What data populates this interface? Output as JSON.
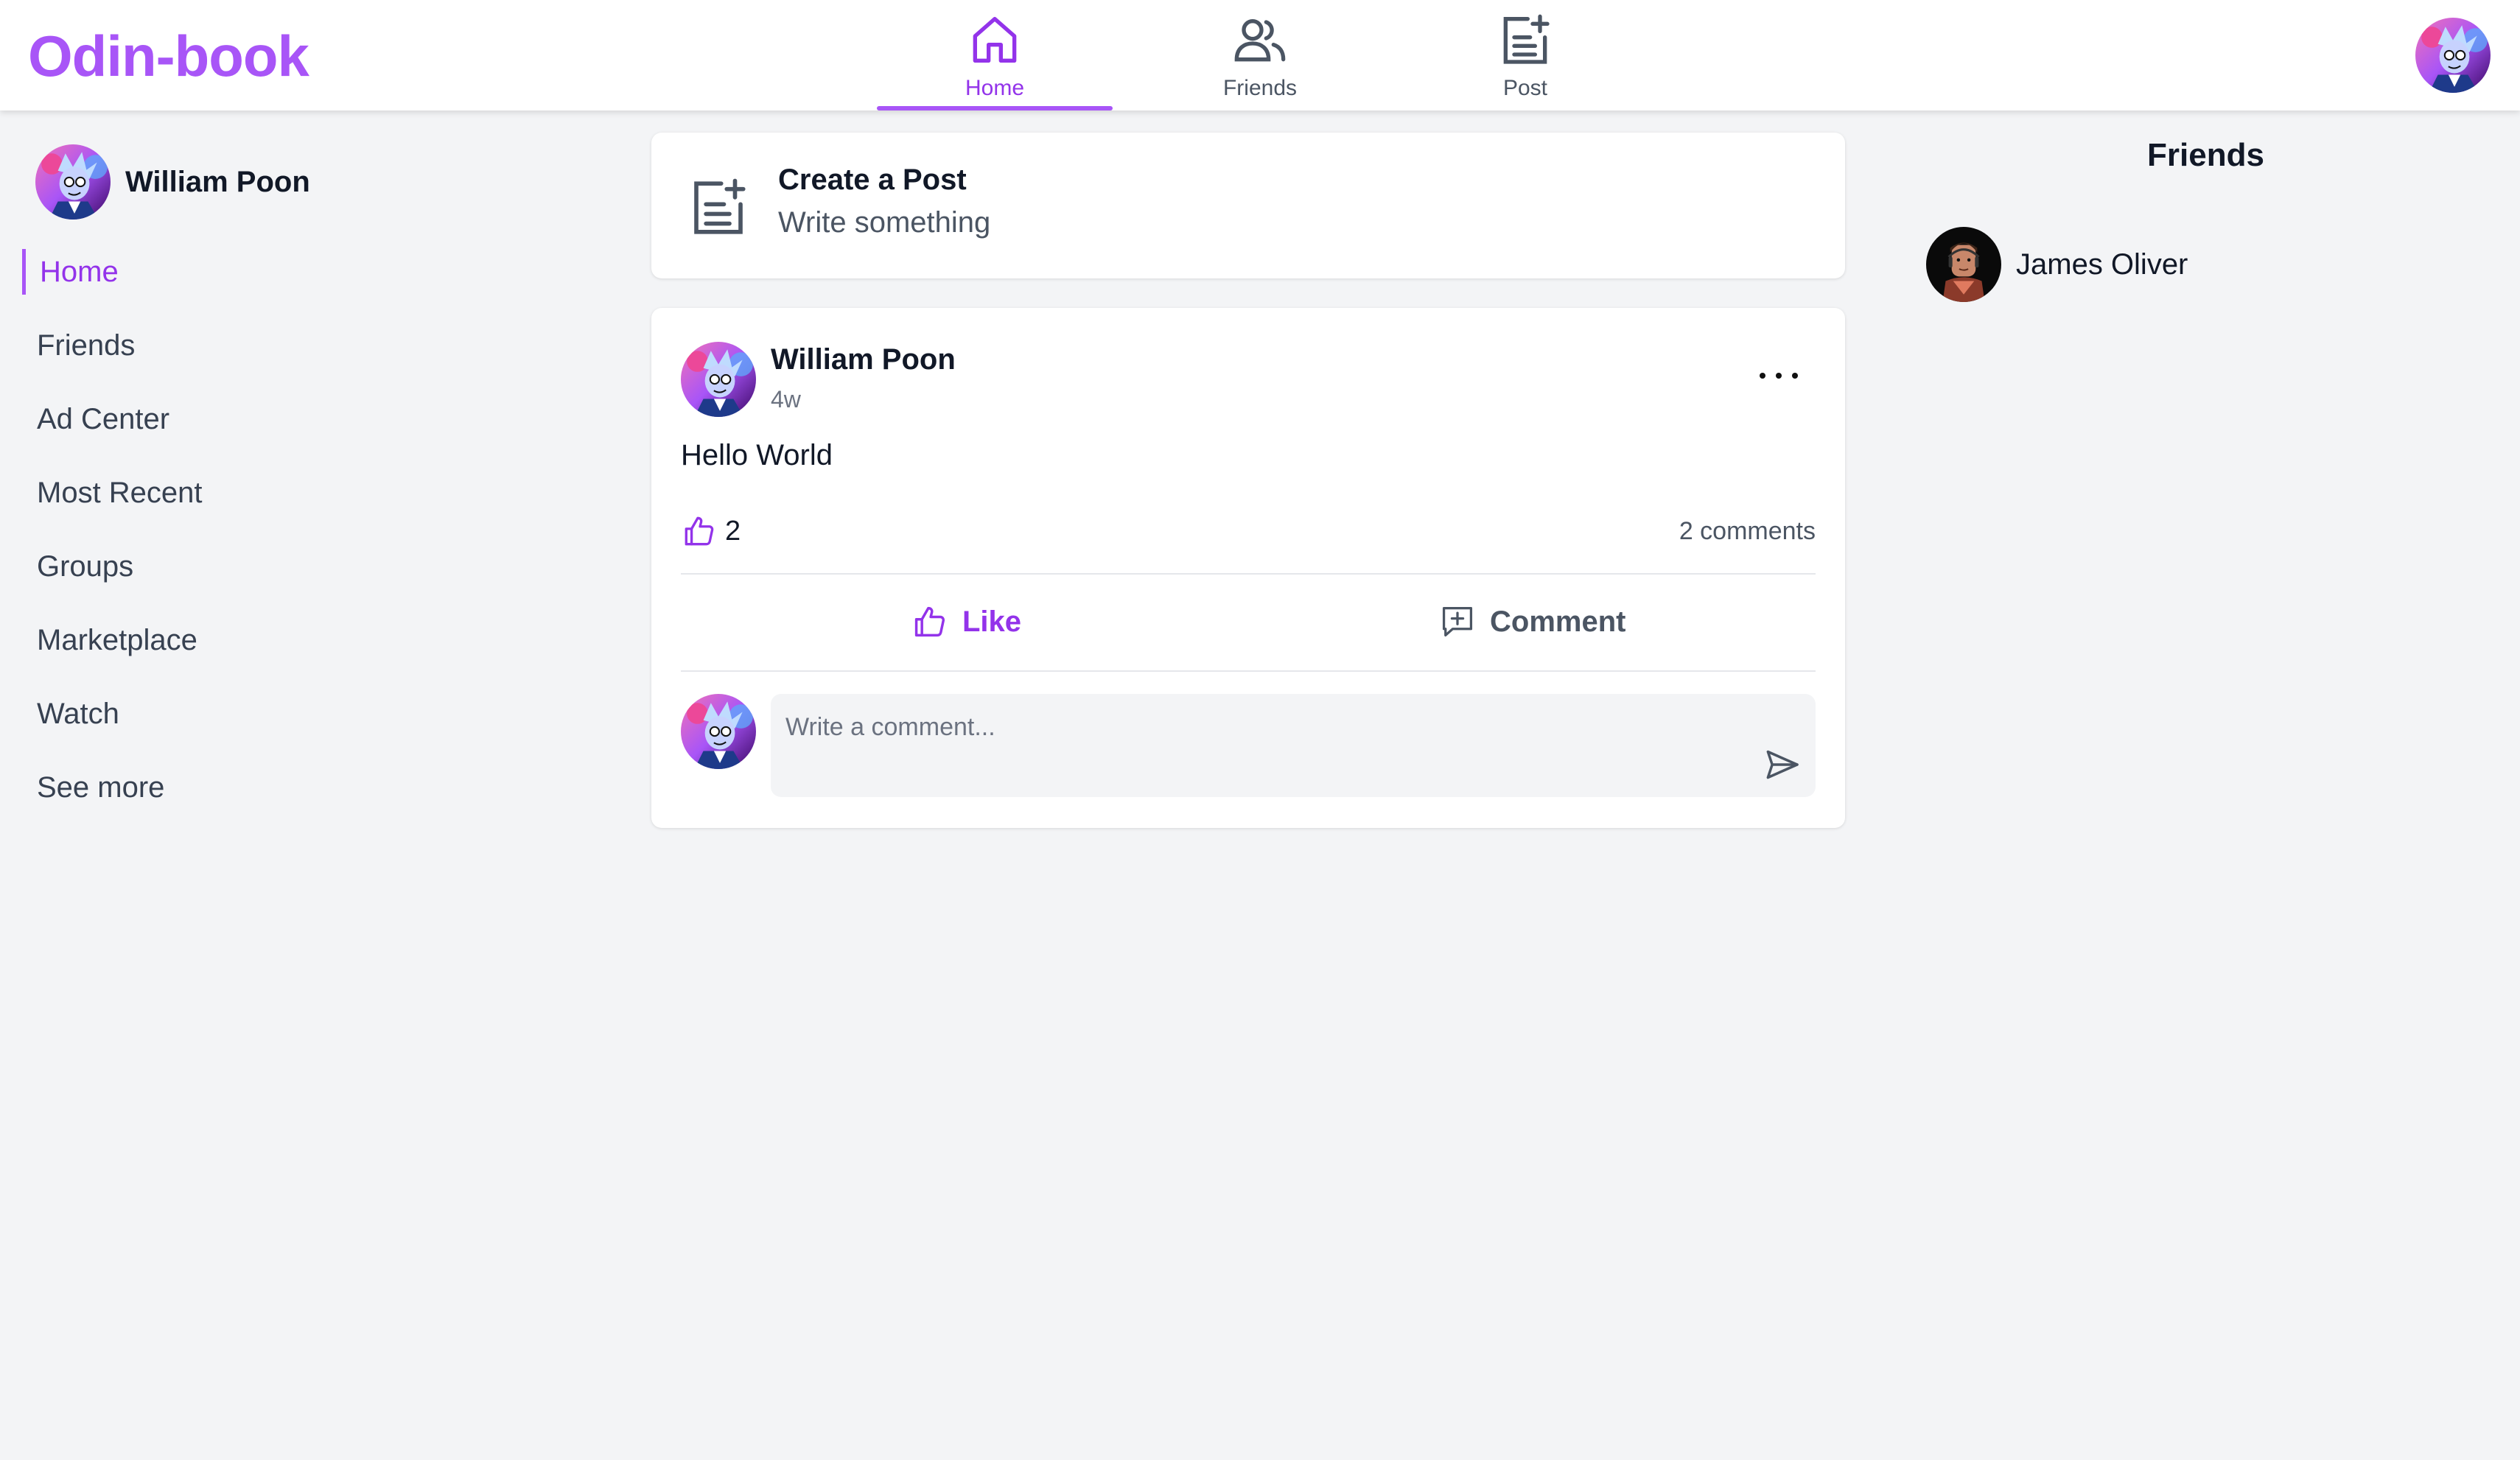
{
  "app": {
    "logo": "Odin-book"
  },
  "colors": {
    "brand": "#a855f7",
    "active": "#9333ea",
    "background": "#f3f4f6",
    "muted": "#4b5563"
  },
  "topnav": {
    "tabs": [
      {
        "label": "Home",
        "icon": "home-icon",
        "active": true
      },
      {
        "label": "Friends",
        "icon": "users-icon",
        "active": false
      },
      {
        "label": "Post",
        "icon": "post-add-icon",
        "active": false
      }
    ],
    "avatar_icon": "user-avatar"
  },
  "sidebar": {
    "user_name": "William Poon",
    "items": [
      {
        "label": "Home",
        "active": true
      },
      {
        "label": "Friends"
      },
      {
        "label": "Ad Center"
      },
      {
        "label": "Most Recent"
      },
      {
        "label": "Groups"
      },
      {
        "label": "Marketplace"
      },
      {
        "label": "Watch"
      },
      {
        "label": "See more"
      }
    ]
  },
  "create_post": {
    "title": "Create a Post",
    "subtitle": "Write something",
    "icon": "post-add-icon"
  },
  "post": {
    "author": "William Poon",
    "time": "4w",
    "body": "Hello World",
    "likes": "2",
    "comments_count": "2 comments",
    "like_label": "Like",
    "comment_label": "Comment",
    "comment_placeholder": "Write a comment...",
    "more_icon": "more-horizontal-icon",
    "send_icon": "send-icon"
  },
  "friends_panel": {
    "title": "Friends",
    "friends": [
      {
        "name": "James Oliver"
      }
    ]
  }
}
